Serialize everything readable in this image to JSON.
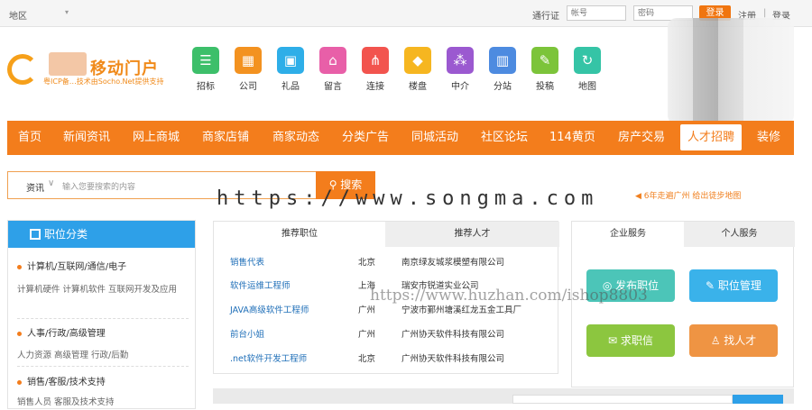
{
  "topbar": {
    "region": "地区",
    "passport_label": "通行证",
    "username_placeholder": "帐号",
    "password_placeholder": "密码",
    "login_button": "登录",
    "register_link": "注册",
    "separator": "|",
    "login_link": "登录"
  },
  "logo": {
    "name": "移动门户",
    "subtitle": "粤ICP备…技术由Socho.Net提供支持"
  },
  "quick_icons": [
    {
      "label": "招标",
      "icon": "list-icon",
      "color": "#3dbf6a"
    },
    {
      "label": "公司",
      "icon": "grid-icon",
      "color": "#f39220"
    },
    {
      "label": "礼品",
      "icon": "bag-icon",
      "color": "#2eaee8"
    },
    {
      "label": "留言",
      "icon": "store-icon",
      "color": "#e85fa8"
    },
    {
      "label": "连接",
      "icon": "share-icon",
      "color": "#f2544e"
    },
    {
      "label": "楼盘",
      "icon": "tag-icon",
      "color": "#f6b620"
    },
    {
      "label": "中介",
      "icon": "network-icon",
      "color": "#9b59d0"
    },
    {
      "label": "分站",
      "icon": "building-icon",
      "color": "#4d8be0"
    },
    {
      "label": "投稿",
      "icon": "edit-icon",
      "color": "#7cc43a"
    },
    {
      "label": "地图",
      "icon": "refresh-icon",
      "color": "#35c4a6"
    }
  ],
  "nav": {
    "items": [
      "首页",
      "新闻资讯",
      "网上商城",
      "商家店铺",
      "商家动态",
      "分类广告",
      "同城活动",
      "社区论坛",
      "114黄页",
      "房产交易",
      "人才招聘",
      "装修"
    ],
    "active": "人才招聘"
  },
  "search": {
    "category": "资讯",
    "placeholder": "输入您要搜索的内容",
    "button": "搜索"
  },
  "watermark_text": "https://www.songma.com",
  "watermark_text2": "https://www.huzhan.com/ishop8803",
  "notice": "6年走遍广州 给出徒步地图",
  "sidebar": {
    "title": "职位分类",
    "categories": [
      {
        "name": "计算机/互联网/通信/电子",
        "sub": "计算机硬件 计算机软件 互联网开发及应用"
      },
      {
        "name": "人事/行政/高级管理",
        "sub": "人力资源 高级管理 行政/后勤"
      },
      {
        "name": "销售/客服/技术支持",
        "sub": "销售人员 客服及技术支持"
      }
    ]
  },
  "jobs": {
    "tab_recommended": "推荐职位",
    "tab_talent": "推荐人才",
    "rows": [
      {
        "title": "销售代表",
        "city": "北京",
        "company": "南京绿友城浆模塑有限公司"
      },
      {
        "title": "软件运维工程师",
        "city": "上海",
        "company": "瑞安市锐道实业公司"
      },
      {
        "title": "JAVA高级软件工程师",
        "city": "广州",
        "company": "宁波市鄞州塘溪红龙五金工具厂"
      },
      {
        "title": "前台小姐",
        "city": "广州",
        "company": "广州协天软件科技有限公司"
      },
      {
        "title": ".net软件开发工程师",
        "city": "北京",
        "company": "广州协天软件科技有限公司"
      }
    ]
  },
  "services": {
    "tab_enterprise": "企业服务",
    "tab_personal": "个人服务",
    "buttons": [
      {
        "label": "发布职位",
        "icon": "target-icon",
        "color": "#4cc5b8"
      },
      {
        "label": "职位管理",
        "icon": "edit-icon",
        "color": "#3ab2ea"
      },
      {
        "label": "求职信",
        "icon": "mail-icon",
        "color": "#8cc63f"
      },
      {
        "label": "找人才",
        "icon": "user-icon",
        "color": "#ef9443"
      }
    ]
  }
}
